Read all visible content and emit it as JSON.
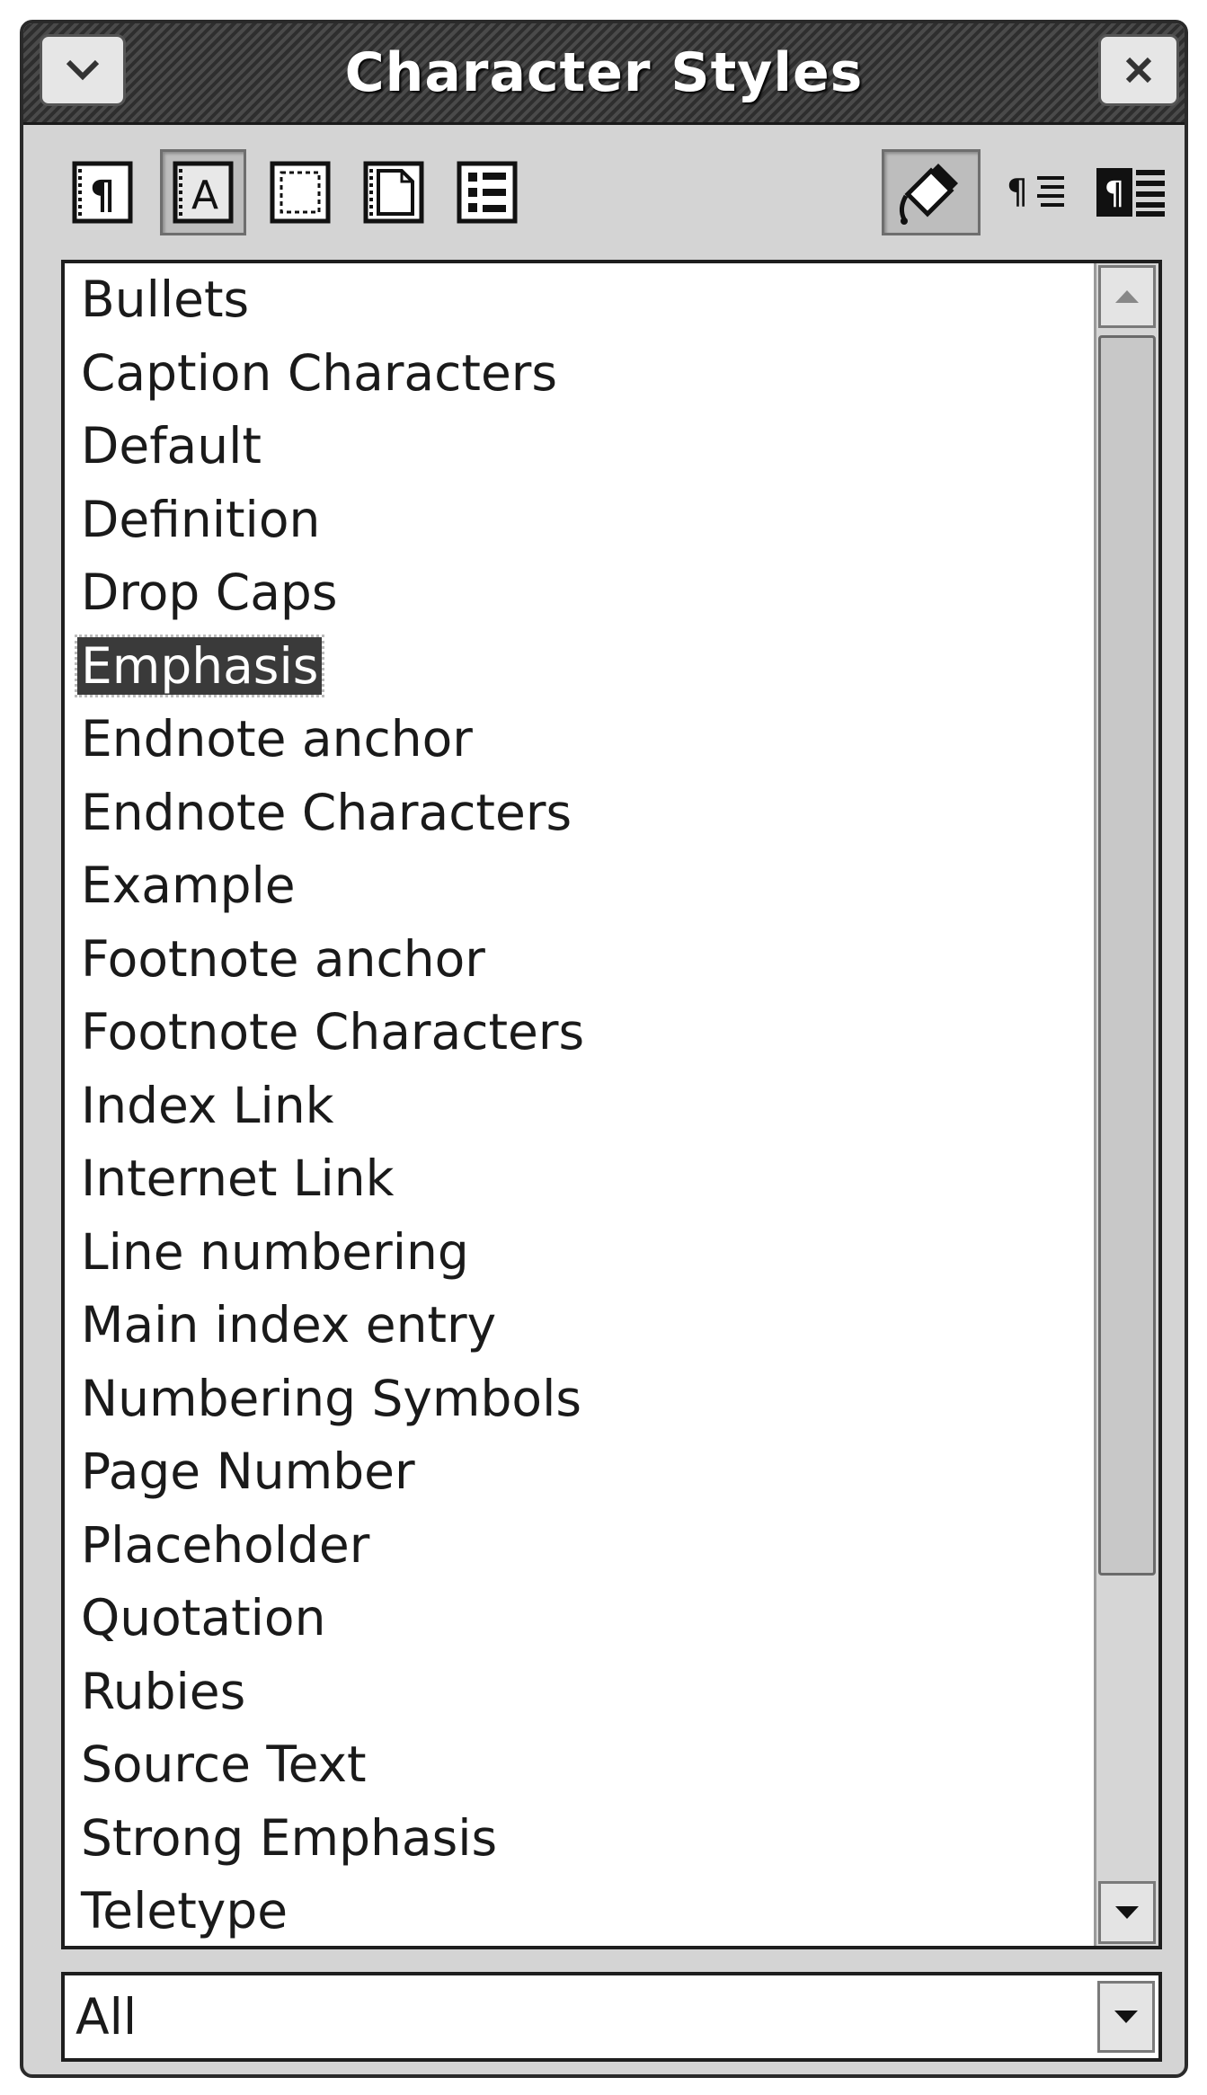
{
  "window": {
    "title": "Character Styles"
  },
  "toolbar": {
    "style_categories": [
      {
        "icon": "paragraph-styles-icon"
      },
      {
        "icon": "character-styles-icon",
        "active": true
      },
      {
        "icon": "frame-styles-icon"
      },
      {
        "icon": "page-styles-icon"
      },
      {
        "icon": "list-styles-icon"
      }
    ],
    "actions": [
      {
        "icon": "fill-format-mode-icon",
        "active": true
      },
      {
        "icon": "new-style-from-selection-icon"
      },
      {
        "icon": "update-style-icon"
      }
    ]
  },
  "style_list": {
    "items": [
      "Bullets",
      "Caption Characters",
      "Default",
      "Definition",
      "Drop Caps",
      "Emphasis",
      "Endnote anchor",
      "Endnote Characters",
      "Example",
      "Footnote anchor",
      "Footnote Characters",
      "Index Link",
      "Internet Link",
      "Line numbering",
      "Main index entry",
      "Numbering Symbols",
      "Page Number",
      "Placeholder",
      "Quotation",
      "Rubies",
      "Source Text",
      "Strong Emphasis",
      "Teletype"
    ],
    "selected": "Emphasis"
  },
  "filter": {
    "value": "All"
  },
  "colors": {
    "selection_bg": "#3a3a3a",
    "window_bg": "#d4d4d4"
  }
}
